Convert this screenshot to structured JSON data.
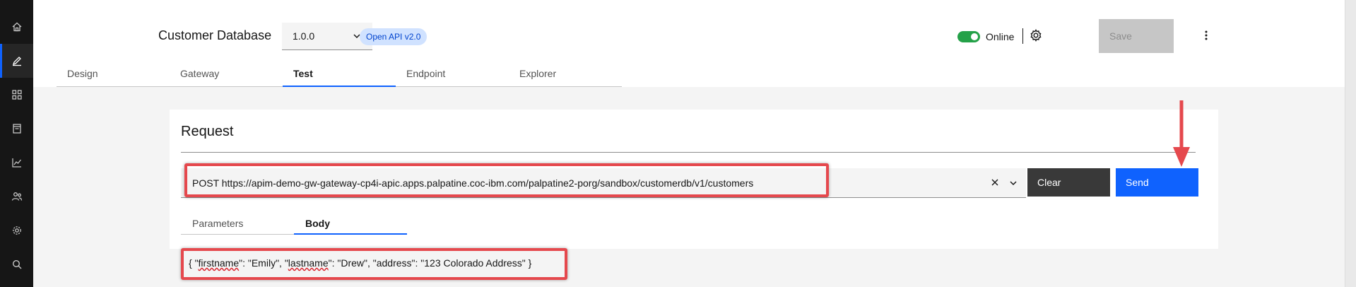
{
  "header": {
    "api_title": "Customer Database",
    "version": "1.0.0",
    "spec_tag": "Open API v2.0",
    "status_label": "Online",
    "save_label": "Save"
  },
  "tabs": [
    {
      "label": "Design",
      "active": false
    },
    {
      "label": "Gateway",
      "active": false
    },
    {
      "label": "Test",
      "active": true
    },
    {
      "label": "Endpoint",
      "active": false
    },
    {
      "label": "Explorer",
      "active": false
    }
  ],
  "request": {
    "title": "Request",
    "url": "POST https://apim-demo-gw-gateway-cp4i-apic.apps.palpatine.coc-ibm.com/palpatine2-porg/sandbox/customerdb/v1/customers",
    "clear_label": "Clear",
    "send_label": "Send",
    "subtabs": [
      {
        "label": "Parameters",
        "active": false
      },
      {
        "label": "Body",
        "active": true
      }
    ],
    "body": {
      "open": "{ \"",
      "key1": "firstname",
      "mid1": "\": \"Emily\", \"",
      "key2": "lastname",
      "rest": "\": \"Drew\", \"address\": \"123 Colorado Address\" }"
    }
  },
  "sidebar_icons": [
    "home-icon",
    "edit-icon",
    "grid-icon",
    "document-icon",
    "chart-icon",
    "users-icon",
    "settings-icon",
    "search-icon"
  ],
  "colors": {
    "primary": "#0f62fe",
    "toggle_on": "#24a148",
    "annotation": "#e5484d",
    "sidebar": "#161616"
  }
}
